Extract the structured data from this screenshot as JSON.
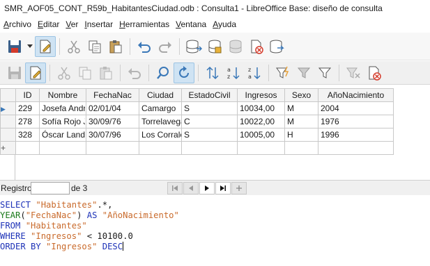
{
  "window": {
    "title": "SMR_AOF05_CONT_R59b_HabitantesCiudad.odb : Consulta1 - LibreOffice Base: diseño de consulta"
  },
  "menubar": {
    "items": [
      {
        "underline": "A",
        "rest": "rchivo"
      },
      {
        "underline": "E",
        "rest": "ditar"
      },
      {
        "underline": "V",
        "rest": "er"
      },
      {
        "underline": "I",
        "rest": "nsertar"
      },
      {
        "underline": "H",
        "rest": "erramientas"
      },
      {
        "underline": "V",
        "rest": "entana"
      },
      {
        "underline": "A",
        "rest": "yuda"
      }
    ]
  },
  "grid": {
    "columns": [
      "ID",
      "Nombre",
      "FechaNac",
      "Ciudad",
      "EstadoCivil",
      "Ingresos",
      "Sexo",
      "AñoNacimiento"
    ],
    "rows": [
      [
        "229",
        "Josefa Andr",
        "02/01/04",
        "Camargo",
        "S",
        "10034,00",
        "M",
        "2004"
      ],
      [
        "278",
        "Sofía  Rojo J",
        "30/09/76",
        "Torrelavega",
        "C",
        "10022,00",
        "M",
        "1976"
      ],
      [
        "328",
        "Óscar  Land",
        "30/07/96",
        "Los Corrale",
        "S",
        "10005,00",
        "H",
        "1996"
      ]
    ],
    "current_row_marker": "▶",
    "new_row_marker": "+"
  },
  "navigator": {
    "record_label": "Registro",
    "record_value": "",
    "of_label": "de 3",
    "buttons": [
      "first",
      "previous",
      "next",
      "last",
      "new"
    ]
  },
  "sql": {
    "lines": [
      [
        {
          "t": "kw",
          "v": "SELECT "
        },
        {
          "t": "str",
          "v": "\"Habitantes\""
        },
        {
          "t": "txt",
          "v": ".*,"
        }
      ],
      [
        {
          "t": "fn",
          "v": "YEAR"
        },
        {
          "t": "txt",
          "v": "("
        },
        {
          "t": "str",
          "v": "\"FechaNac\""
        },
        {
          "t": "txt",
          "v": ") "
        },
        {
          "t": "kw",
          "v": "AS "
        },
        {
          "t": "str",
          "v": "\"AñoNacimiento\""
        }
      ],
      [
        {
          "t": "kw",
          "v": "FROM "
        },
        {
          "t": "str",
          "v": "\"Habitantes\""
        }
      ],
      [
        {
          "t": "kw",
          "v": "WHERE "
        },
        {
          "t": "str",
          "v": "\"Ingresos\""
        },
        {
          "t": "txt",
          "v": " < 10100.0"
        }
      ],
      [
        {
          "t": "kw",
          "v": "ORDER BY "
        },
        {
          "t": "str",
          "v": "\"Ingresos\""
        },
        {
          "t": "kw",
          "v": " DESC"
        }
      ]
    ]
  },
  "toolbar1": {
    "icons": [
      "save-icon",
      "save-dropdown-icon",
      "edit-mode-icon",
      "cut-icon",
      "copy-icon",
      "paste-icon",
      "undo-icon",
      "redo-icon",
      "add-tables-icon",
      "add-query-icon",
      "switch-design-view-icon",
      "delete-icon",
      "sql-direct-icon"
    ]
  },
  "toolbar2": {
    "icons": [
      "save-record-icon",
      "edit-data-icon",
      "cut-icon",
      "copy-icon",
      "paste-icon",
      "undo-icon",
      "find-record-icon",
      "refresh-icon",
      "sort-icon",
      "sort-ascending-icon",
      "sort-descending-icon",
      "autofilter-icon",
      "apply-filter-icon",
      "standard-filter-icon",
      "reset-filter-icon",
      "delete-record-icon"
    ]
  },
  "colors": {
    "keyword": "#1e33b8",
    "function": "#1b7a1b",
    "string": "#c96a2b",
    "active_button": "#cfe3f3",
    "icon_blue": "#3a78b8",
    "icon_red": "#d43a2a"
  }
}
